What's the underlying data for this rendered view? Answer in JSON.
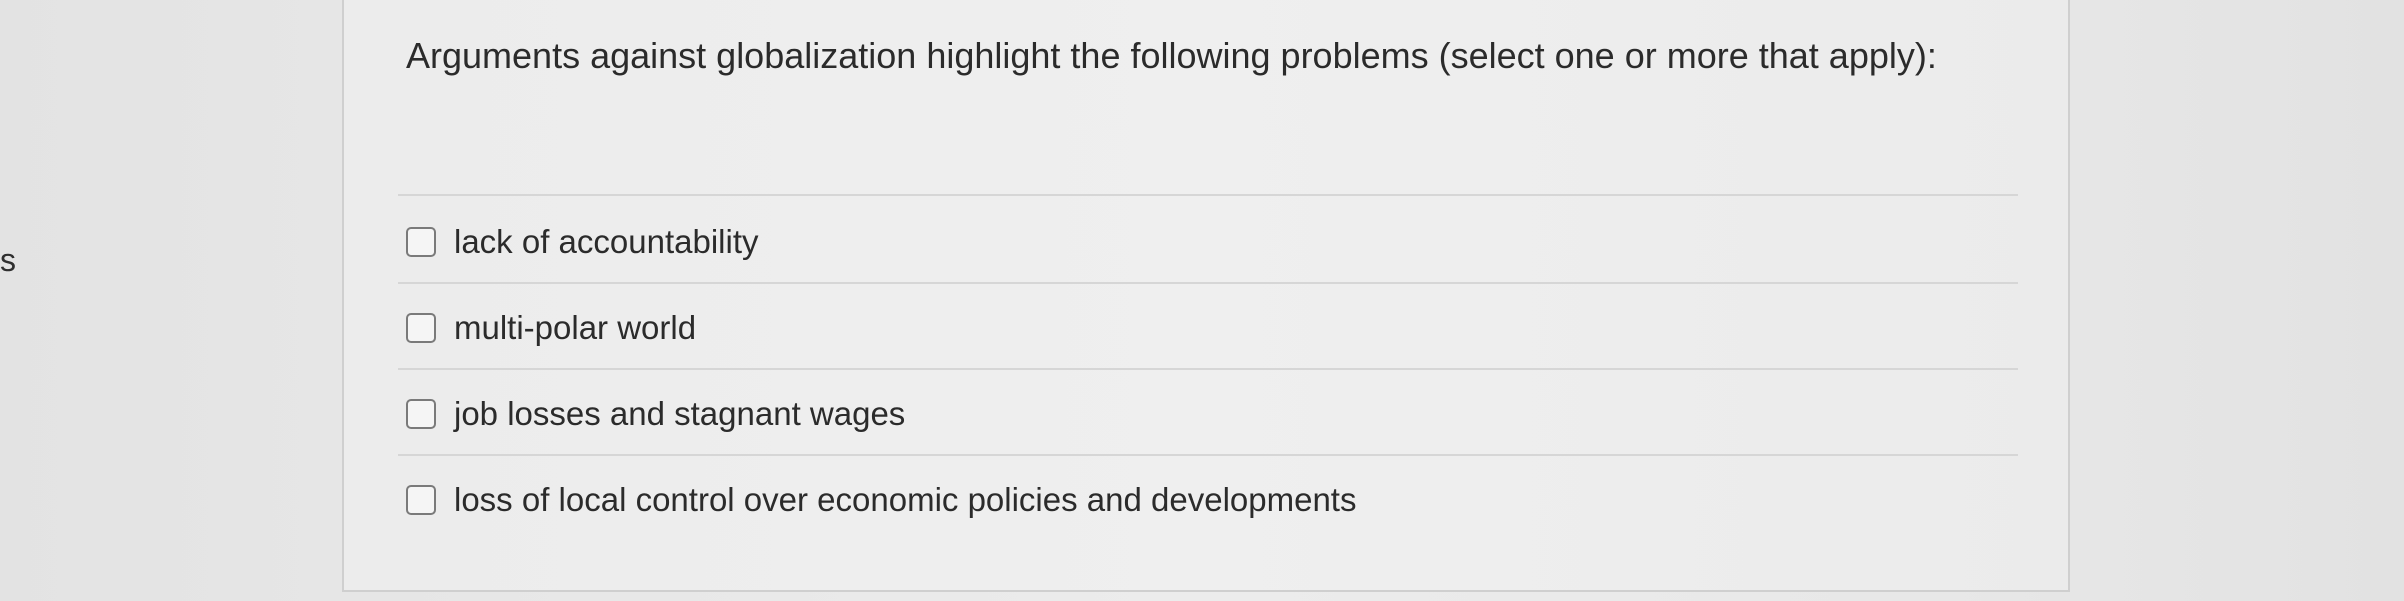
{
  "side_text": "s",
  "question": {
    "prompt": "Arguments against globalization highlight the following problems (select one or more that apply):",
    "options": [
      {
        "label": "lack of accountability",
        "checked": false
      },
      {
        "label": "multi-polar world",
        "checked": false
      },
      {
        "label": "job losses and stagnant wages",
        "checked": false
      },
      {
        "label": "loss of local control over economic policies and developments",
        "checked": false
      }
    ]
  }
}
